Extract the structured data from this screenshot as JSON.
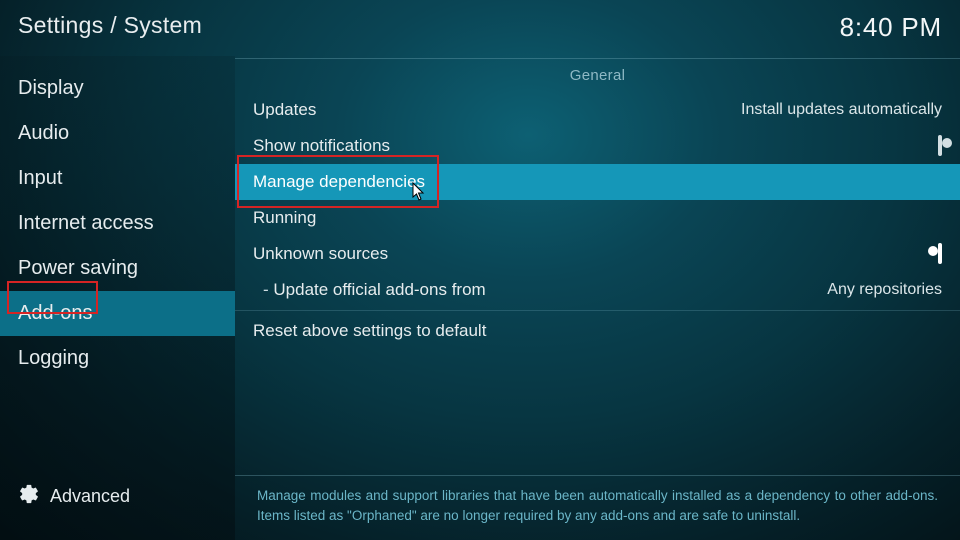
{
  "header": {
    "breadcrumb": "Settings / System",
    "clock": "8:40 PM"
  },
  "sidebar": {
    "items": [
      {
        "label": "Display"
      },
      {
        "label": "Audio"
      },
      {
        "label": "Input"
      },
      {
        "label": "Internet access"
      },
      {
        "label": "Power saving"
      },
      {
        "label": "Add-ons",
        "selected": true
      },
      {
        "label": "Logging"
      }
    ],
    "level_label": "Advanced"
  },
  "content": {
    "section_header": "General",
    "rows": {
      "updates": {
        "label": "Updates",
        "value": "Install updates automatically"
      },
      "show_notifications": {
        "label": "Show notifications",
        "toggle": "off"
      },
      "manage_dependencies": {
        "label": "Manage dependencies",
        "selected": true
      },
      "running": {
        "label": "Running"
      },
      "unknown_sources": {
        "label": "Unknown sources",
        "toggle": "on"
      },
      "update_official": {
        "label": "Update official add-ons from",
        "value": "Any repositories"
      },
      "reset": {
        "label": "Reset above settings to default"
      }
    }
  },
  "help": "Manage modules and support libraries that have been automatically installed as a dependency to other add-ons. Items listed as \"Orphaned\" are no longer required by any add-ons and are safe to uninstall."
}
